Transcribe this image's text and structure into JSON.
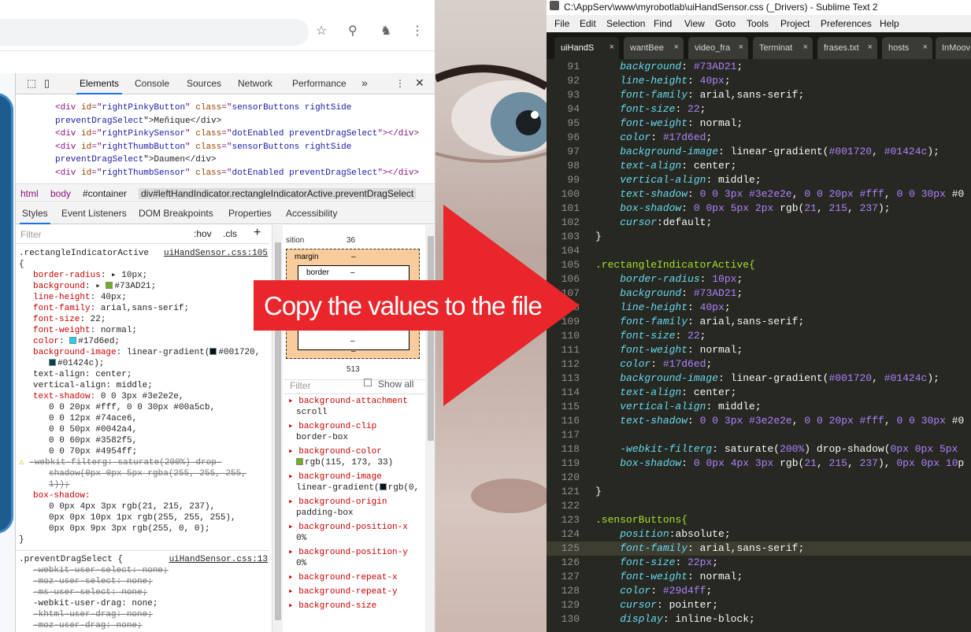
{
  "browser": {
    "toolbar_icons": [
      "star-icon",
      "extension-icon",
      "profile-icon",
      "menu-dots-icon"
    ],
    "devtools_tabs": [
      "Elements",
      "Console",
      "Sources",
      "Network",
      "Performance",
      "»"
    ],
    "dom_lines": [
      [
        "<div id=\"",
        "rightPinkyButton",
        "\" class=\"",
        "sensorButtons rightSide",
        ""
      ],
      [
        "preventDragSelect",
        "\">Meñique</div>"
      ],
      [
        "<div id=\"",
        "rightPinkySensor",
        "\" class=\"",
        "dotEnabled preventDragSelect",
        "\"></div>"
      ],
      [
        "<div id=\"",
        "rightThumbButton",
        "\" class=\"",
        "sensorButtons rightSide",
        ""
      ],
      [
        "preventDragSelect",
        "\">Daumen</div>"
      ],
      [
        "<div id=\"",
        "rightThumbSensor",
        "\" class=\"",
        "dotEnabled preventDragSelect",
        "\"></div>"
      ]
    ],
    "breadcrumbs": [
      "html",
      "body",
      "#container",
      "div#leftHandIndicator.rectangleIndicatorActive.preventDragSelect"
    ],
    "style_tabs": [
      "Styles",
      "Event Listeners",
      "DOM Breakpoints",
      "Properties",
      "Accessibility"
    ],
    "filter_placeholder": "Filter",
    "hov": ":hov",
    "cls": ".cls",
    "plus": "+",
    "rule1": {
      "selector": ".rectangleIndicatorActive",
      "source": "uiHandSensor.css:105",
      "open": "{",
      "close": "}",
      "decls": [
        {
          "p": "border-radius",
          "v": "10px;",
          "sw": ""
        },
        {
          "p": "background",
          "v": "#73AD21;",
          "sw": "#73AD21"
        },
        {
          "p": "line-height",
          "v": "40px;",
          "sw": ""
        },
        {
          "p": "font-family",
          "v": "arial,sans-serif;",
          "sw": ""
        },
        {
          "p": "font-size",
          "v": "22;",
          "sw": ""
        },
        {
          "p": "font-weight",
          "v": "normal;",
          "sw": ""
        },
        {
          "p": "color",
          "v": "#17d6ed;",
          "sw": "#17d6ed"
        },
        {
          "p": "background-image",
          "v": "linear-gradient(#001720,",
          "sw": "#001720"
        }
      ],
      "bg_image_cont": "#01424c);",
      "text_align": "text-align: center;",
      "vertical_align": "vertical-align: middle;",
      "text_shadow_label": "text-shadow:",
      "text_shadow_lines": [
        "0 0 3px #3e2e2e,",
        "0 0 20px #fff, 0 0 30px #00a5cb,",
        "0 0 12px #74ace6,",
        "0 0 50px #0042a4,",
        "0 0 60px #3582f5,",
        "0 0 70px #4954ff;"
      ],
      "filter_strike": "-webkit-filterg: saturate(200%) drop-",
      "filter_strike2": "shadow(0px 0px 5px rgba(255, 255, 255,",
      "filter_strike3": "1));",
      "box_shadow_label": "box-shadow:",
      "box_shadow_lines": [
        "0 0px 4px 3px rgb(21, 215, 237),",
        "0px 0px 10px 1px rgb(255, 255, 255),",
        "0px 0px 9px 3px rgb(255, 0, 0);"
      ]
    },
    "rule2": {
      "selector": ".preventDragSelect {",
      "source": "uiHandSensor.css:13",
      "decls": [
        "-webkit-user-select: none;",
        "-moz-user-select: none;",
        "-ms-user-select: none;",
        "-webkit-user-drag: none;",
        "-khtml-user-drag: none;",
        "-moz-user-drag: none;"
      ]
    },
    "boxmodel": {
      "position_label": "sition",
      "position_value": "36",
      "margin_label": "margin",
      "border_label": "border",
      "dash": "–",
      "bottom_value": "513"
    },
    "computed_filter": "Filter",
    "show_all": "Show all",
    "computed": [
      {
        "p": "background-attachment",
        "v": "scroll"
      },
      {
        "p": "background-clip",
        "v": "border-box"
      },
      {
        "p": "background-color",
        "v": "rgb(115, 173, 33)"
      },
      {
        "p": "background-image",
        "v": "linear-gradient(rgb(0,"
      },
      {
        "p": "background-origin",
        "v": "padding-box"
      },
      {
        "p": "background-position-x",
        "v": "0%"
      },
      {
        "p": "background-position-y",
        "v": "0%"
      },
      {
        "p": "background-repeat-x",
        "v": ""
      },
      {
        "p": "background-repeat-y",
        "v": ""
      },
      {
        "p": "background-size",
        "v": ""
      }
    ]
  },
  "arrow": {
    "text": "Copy the values to the file",
    "color": "#e8262c"
  },
  "sublime": {
    "title": "C:\\AppServ\\www\\myrobotlab\\uiHandSensor.css (_Drivers) - Sublime Text 2",
    "menu": [
      "File",
      "Edit",
      "Selection",
      "Find",
      "View",
      "Goto",
      "Tools",
      "Project",
      "Preferences",
      "Help"
    ],
    "tabs": [
      "uiHandS",
      "wantBee",
      "video_fra",
      "Terminat",
      "frases.txt",
      "hosts",
      "InMoov"
    ],
    "close_glyph": "×",
    "current_line": 125,
    "lines": [
      {
        "n": "91",
        "c": "    background: #73AD21;"
      },
      {
        "n": "92",
        "c": "    line-height: 40px;"
      },
      {
        "n": "93",
        "c": "    font-family: arial,sans-serif;"
      },
      {
        "n": "94",
        "c": "    font-size: 22;"
      },
      {
        "n": "95",
        "c": "    font-weight: normal;"
      },
      {
        "n": "96",
        "c": "    color: #17d6ed;"
      },
      {
        "n": "97",
        "c": "    background-image: linear-gradient(#001720, #01424c);"
      },
      {
        "n": "98",
        "c": "    text-align: center;"
      },
      {
        "n": "99",
        "c": "    vertical-align: middle;"
      },
      {
        "n": "100",
        "c": "    text-shadow: 0 0 3px #3e2e2e, 0 0 20px #fff, 0 0 30px #0"
      },
      {
        "n": "101",
        "c": "    box-shadow: 0 0px 5px 2px rgb(21, 215, 237);"
      },
      {
        "n": "102",
        "c": "    cursor:default;"
      },
      {
        "n": "103",
        "c": "}"
      },
      {
        "n": "104",
        "c": ""
      },
      {
        "n": "105",
        "c": ".rectangleIndicatorActive{"
      },
      {
        "n": "106",
        "c": "    border-radius: 10px;"
      },
      {
        "n": "107",
        "c": "    background: #73AD21;"
      },
      {
        "n": "108",
        "c": "    line-height: 40px;"
      },
      {
        "n": "109",
        "c": "    font-family: arial,sans-serif;"
      },
      {
        "n": "110",
        "c": "    font-size: 22;"
      },
      {
        "n": "111",
        "c": "    font-weight: normal;"
      },
      {
        "n": "112",
        "c": "    color: #17d6ed;"
      },
      {
        "n": "113",
        "c": "    background-image: linear-gradient(#001720, #01424c);"
      },
      {
        "n": "114",
        "c": "    text-align: center;"
      },
      {
        "n": "115",
        "c": "    vertical-align: middle;"
      },
      {
        "n": "116",
        "c": "    text-shadow: 0 0 3px #3e2e2e, 0 0 20px #fff, 0 0 30px #0"
      },
      {
        "n": "117",
        "c": ""
      },
      {
        "n": "118",
        "c": "    -webkit-filterg: saturate(200%)  drop-shadow(0px 0px 5px"
      },
      {
        "n": "119",
        "c": "    box-shadow: 0 0px 4px 3px rgb(21, 215, 237), 0px 0px 10p"
      },
      {
        "n": "120",
        "c": ""
      },
      {
        "n": "121",
        "c": "}"
      },
      {
        "n": "122",
        "c": ""
      },
      {
        "n": "123",
        "c": ".sensorButtons{"
      },
      {
        "n": "124",
        "c": "    position:absolute;"
      },
      {
        "n": "125",
        "c": "    font-family: arial,sans-serif;"
      },
      {
        "n": "126",
        "c": "    font-size: 22px;"
      },
      {
        "n": "127",
        "c": "    font-weight: normal;"
      },
      {
        "n": "128",
        "c": "    color: #29d4ff;"
      },
      {
        "n": "129",
        "c": "    cursor: pointer;"
      },
      {
        "n": "130",
        "c": "    display: inline-block;"
      }
    ]
  }
}
